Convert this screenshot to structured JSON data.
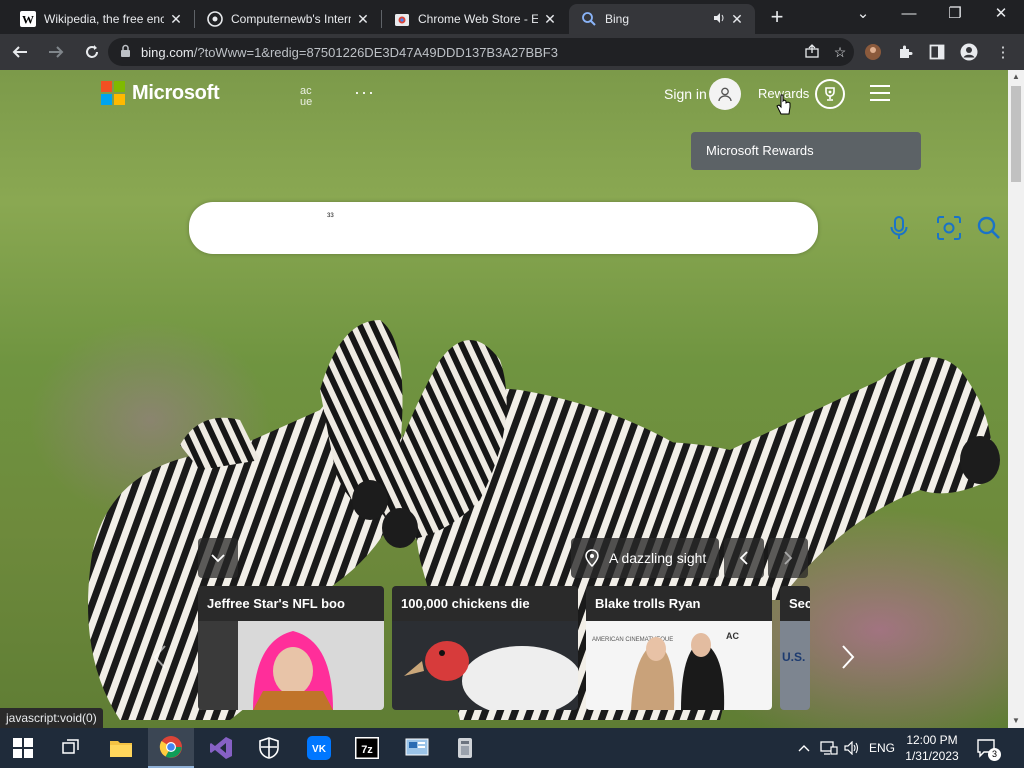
{
  "browser": {
    "tabs": [
      {
        "title": "Wikipedia, the free enc",
        "icon": "wikipedia-icon"
      },
      {
        "title": "Computernewb's Intern",
        "icon": "computernewb-icon"
      },
      {
        "title": "Chrome Web Store - Ex",
        "icon": "chrome-web-store-icon"
      },
      {
        "title": "Bing",
        "icon": "bing-icon",
        "active": true,
        "audio": true
      }
    ],
    "url_host": "bing.com",
    "url_path": "/?toWww=1&redig=87501226DE3D47A49DDD137B3A27BBF3",
    "status_text": "javascript:void(0)"
  },
  "page": {
    "brand": "Microsoft",
    "ghost_text_1": "ac",
    "ghost_text_2": "ue",
    "more_label": "···",
    "signin_label": "Sign in",
    "rewards_label": "Rewards",
    "tooltip": "Microsoft Rewards",
    "search": {
      "value": "",
      "ghost": "³³"
    },
    "image_caption": "A dazzling sight",
    "news_cards": [
      {
        "title": "Jeffree Star's NFL boo"
      },
      {
        "title": "100,000 chickens die"
      },
      {
        "title": "Blake trolls Ryan"
      },
      {
        "title": "Sec"
      }
    ]
  },
  "taskbar": {
    "apps": [
      "start-icon",
      "task-view-icon",
      "file-explorer-icon",
      "chrome-icon",
      "visual-studio-icon",
      "security-icon",
      "vk-icon",
      "7zip-icon",
      "control-panel-icon",
      "app-icon"
    ],
    "language": "ENG",
    "time": "12:00 PM",
    "date": "1/31/2023",
    "notification_count": "3"
  },
  "colors": {
    "chrome_dark": "#202124",
    "chrome_toolbar": "#35363a",
    "bing_blue": "#1a73c8",
    "taskbar": "#1f2b3a"
  }
}
